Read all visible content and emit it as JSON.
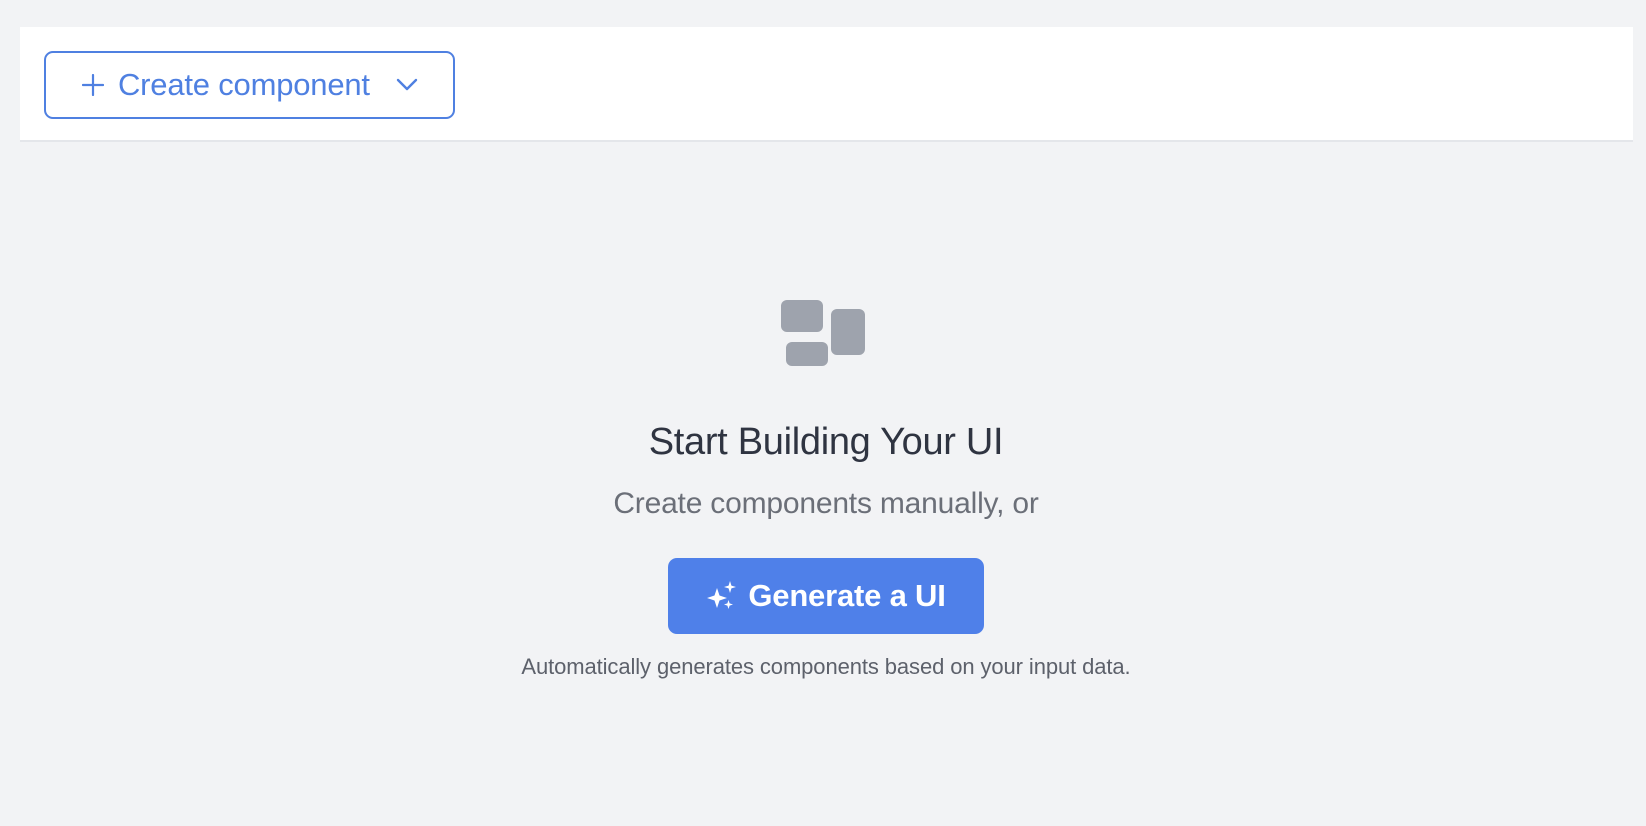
{
  "toolbar": {
    "create_button": {
      "label": "Create component",
      "leading_icon": "plus-icon",
      "trailing_icon": "chevron-down-icon"
    }
  },
  "empty_state": {
    "icon": "components-grid-icon",
    "title": "Start Building Your UI",
    "subtitle": "Create components manually, or",
    "generate_button": {
      "label": "Generate a UI",
      "icon": "sparkle-icon"
    },
    "hint": "Automatically generates components based on your input data."
  },
  "colors": {
    "background": "#f2f3f5",
    "accent": "#4f80e9",
    "icon_gray": "#9ea3ad",
    "title": "#2f3441",
    "subtitle": "#6b6f78"
  }
}
